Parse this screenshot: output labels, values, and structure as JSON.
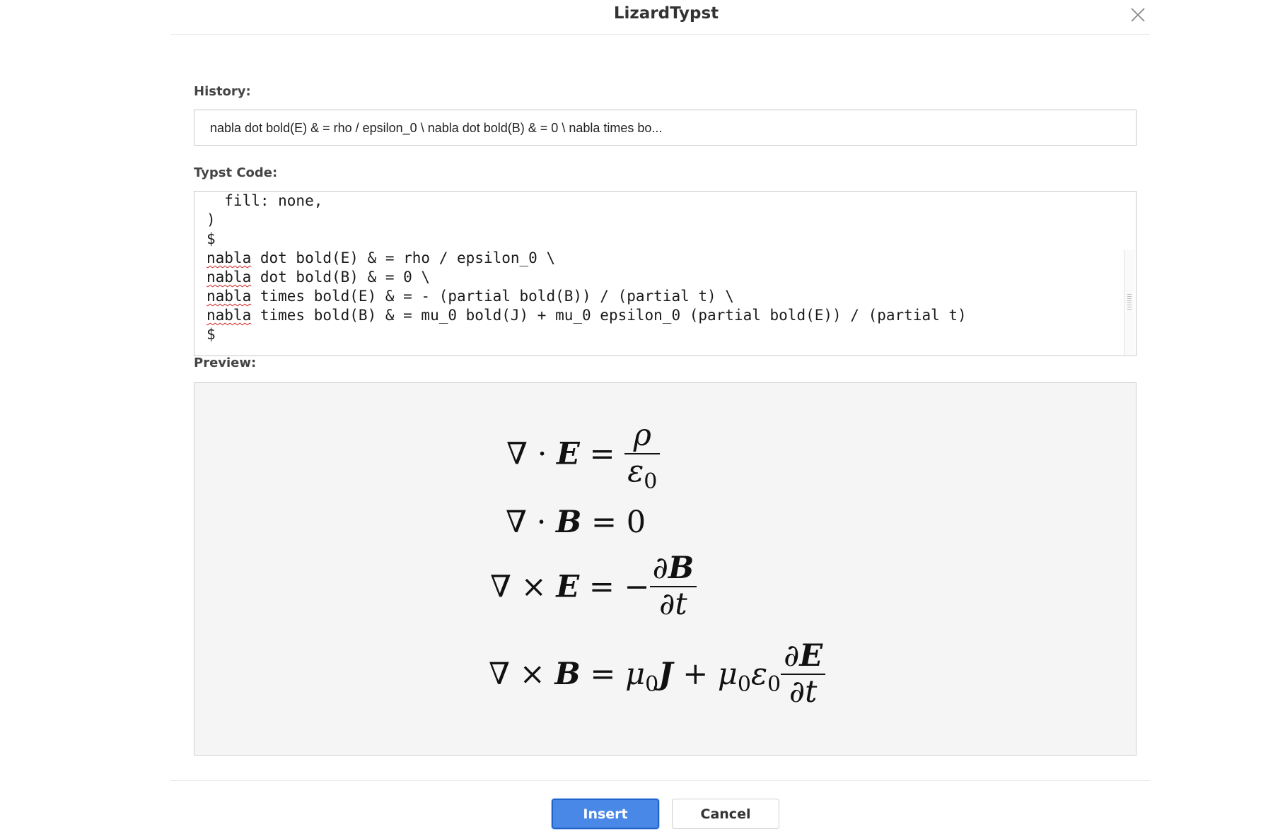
{
  "dialog": {
    "title": "LizardTypst",
    "close_icon": "close-icon"
  },
  "history": {
    "label": "History:",
    "value": "nabla dot bold(E) & = rho / epsilon_0 \\ nabla dot bold(B) & = 0 \\ nabla times bo..."
  },
  "code": {
    "label": "Typst Code:",
    "lines": [
      {
        "squiggle": "",
        "text": "  fill: none,"
      },
      {
        "squiggle": "",
        "text": ")"
      },
      {
        "squiggle": "",
        "text": "$"
      },
      {
        "squiggle": "nabla",
        "text": " dot bold(E) & = rho / epsilon_0 \\"
      },
      {
        "squiggle": "nabla",
        "text": " dot bold(B) & = 0 \\"
      },
      {
        "squiggle": "nabla",
        "text": " times bold(E) & = - (partial bold(B)) / (partial t) \\"
      },
      {
        "squiggle": "nabla",
        "text": " times bold(B) & = mu_0 bold(J) + mu_0 epsilon_0 (partial bold(E)) / (partial t)"
      },
      {
        "squiggle": "",
        "text": "$"
      }
    ]
  },
  "preview": {
    "label": "Preview:"
  },
  "buttons": {
    "insert": "Insert",
    "cancel": "Cancel"
  }
}
